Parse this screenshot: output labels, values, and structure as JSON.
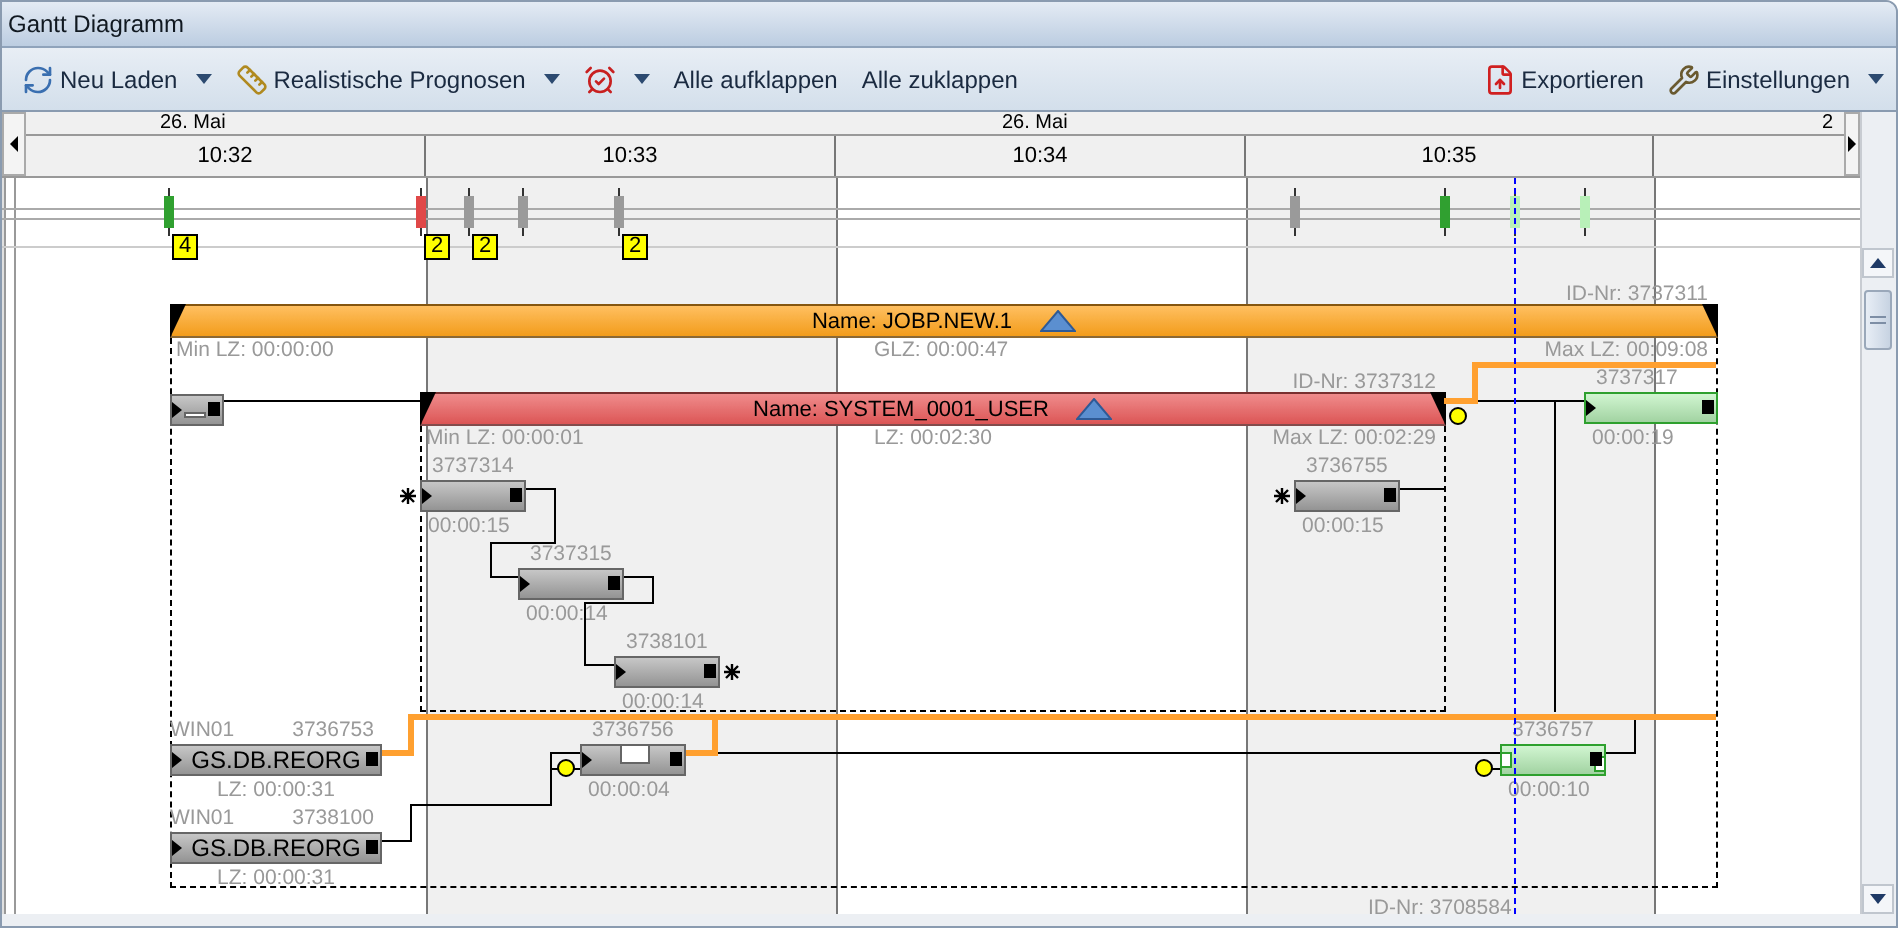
{
  "window": {
    "title": "Gantt Diagramm"
  },
  "toolbar": {
    "left": [
      {
        "label": "Neu Laden",
        "dropdown": true
      },
      {
        "label": "Realistische Prognosen",
        "dropdown": true
      },
      {
        "dropdown": true
      },
      {
        "label": "Alle aufklappen",
        "dropdown": false
      },
      {
        "label": "Alle zuklappen",
        "dropdown": false
      }
    ],
    "right": [
      {
        "label": "Exportieren",
        "dropdown": false
      },
      {
        "label": "Einstellungen",
        "dropdown": true
      }
    ]
  },
  "timeline": {
    "dates": [
      "26. Mai",
      "26. Mai",
      "2"
    ],
    "times": [
      "10:32",
      "10:33",
      "10:34",
      "10:35"
    ]
  },
  "markers": [
    {
      "color": "#30a030",
      "badge": "4"
    },
    {
      "color": "#e04848",
      "badge": "2"
    },
    {
      "color": "#9a9a9a",
      "badge": "2"
    },
    {
      "color": "#9a9a9a"
    },
    {
      "color": "#9a9a9a",
      "badge": "2"
    },
    {
      "color": "#9a9a9a"
    },
    {
      "color": "#30a030"
    },
    {
      "color": "#b8f0b8"
    },
    {
      "color": "#b8f0b8"
    }
  ],
  "groups": [
    {
      "name": "Name: JOBP.NEW.1",
      "id": "ID-Nr: 3737311",
      "min": "Min LZ: 00:00:00",
      "mid": "GLZ: 00:00:47",
      "max": "Max LZ: 00:09:08",
      "color": "#ffa41c"
    },
    {
      "name": "Name: SYSTEM_0001_USER",
      "id": "ID-Nr: 3737312",
      "min": "Min LZ: 00:00:01",
      "mid": "LZ: 00:02:30",
      "max": "Max LZ: 00:02:29",
      "color": "#e85a5a"
    }
  ],
  "tasks": [
    {
      "color": "#a8a8a8",
      "kind": "hook",
      "star_before": false,
      "star_after": false
    },
    {
      "id": "3737314",
      "duration": "00:00:15",
      "color": "#a8a8a8",
      "kind": "bar",
      "star_before": true,
      "star_after": false
    },
    {
      "id": "3737315",
      "duration": "00:00:14",
      "color": "#a8a8a8",
      "kind": "bar",
      "star_before": false,
      "star_after": false
    },
    {
      "id": "3738101",
      "duration": "00:00:14",
      "color": "#a8a8a8",
      "kind": "bar",
      "star_before": false,
      "star_after": true
    },
    {
      "id": "3736755",
      "duration": "00:00:15",
      "color": "#a8a8a8",
      "kind": "bar",
      "star_before": true,
      "star_after": false
    },
    {
      "id": "3737317",
      "duration": "00:00:19",
      "color": "#b8f0b8",
      "kind": "bar",
      "star_before": false,
      "star_after": false
    },
    {
      "agent": "WIN01",
      "id": "3736753",
      "label": "GS.DB.REORG",
      "duration": "LZ: 00:00:31",
      "color": "#a8a8a8",
      "kind": "bar",
      "star_before": false,
      "star_after": false
    },
    {
      "agent": "WIN01",
      "id": "3738100",
      "label": "GS.DB.REORG",
      "duration": "LZ: 00:00:31",
      "color": "#a8a8a8",
      "kind": "bar",
      "star_before": false,
      "star_after": false
    },
    {
      "id": "3736756",
      "duration": "00:00:04",
      "color": "#a8a8a8",
      "kind": "split",
      "star_before": false,
      "star_after": false
    },
    {
      "id": "3736757",
      "duration": "00:00:10",
      "color": "#b8f0b8",
      "kind": "slotted",
      "star_before": false,
      "star_after": false
    }
  ],
  "footer_id": "ID-Nr: 3708584"
}
